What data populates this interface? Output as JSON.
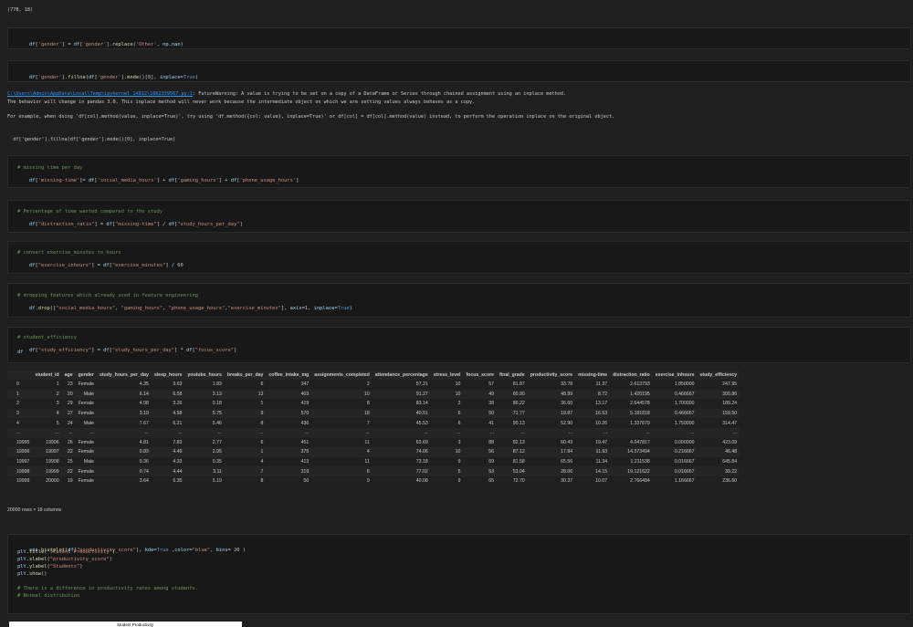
{
  "shape_output": "(778, 18)",
  "cells": [
    {
      "id": "c1",
      "lines": [
        [
          "var",
          "df"
        ],
        [
          "",
          "["
        ],
        [
          "str",
          "'gender'"
        ],
        [
          "",
          "] = "
        ],
        [
          "var",
          "df"
        ],
        [
          "",
          "["
        ],
        [
          "str",
          "'gender'"
        ],
        [
          "",
          "]."
        ],
        [
          "fn",
          "replace"
        ],
        [
          "",
          "("
        ],
        [
          "str",
          "'Other'"
        ],
        [
          "",
          ", "
        ],
        [
          "var",
          "np"
        ],
        [
          "",
          "."
        ],
        [
          "var",
          "nan"
        ],
        [
          "",
          ")"
        ]
      ]
    },
    {
      "id": "c2",
      "lines": [
        [
          "var",
          "df"
        ],
        [
          "",
          "["
        ],
        [
          "str",
          "'gender'"
        ],
        [
          "",
          "]."
        ],
        [
          "fn",
          "fillna"
        ],
        [
          "",
          "("
        ],
        [
          "var",
          "df"
        ],
        [
          "",
          "["
        ],
        [
          "str",
          "'gender'"
        ],
        [
          "",
          "]."
        ],
        [
          "fn",
          "mode"
        ],
        [
          "",
          "()["
        ],
        [
          "num",
          "0"
        ],
        [
          "",
          "], "
        ],
        [
          "var",
          "inplace"
        ],
        [
          "",
          "="
        ],
        [
          "kw",
          "True"
        ],
        [
          "",
          ")"
        ]
      ]
    }
  ],
  "warning": {
    "path": "C:\\Users\\Admin\\AppData\\Local\\Temp\\ipykernel_14812\\1062339567.py:1",
    "line1": ": FutureWarning: A value is trying to be set on a copy of a DataFrame or Series through chained assignment using an inplace method.",
    "line2": "The behavior will change in pandas 3.0. This inplace method will never work because the intermediate object on which we are setting values always behaves as a copy.",
    "line3": "For example, when doing 'df[col].method(value, inplace=True)', try using 'df.method({col: value}, inplace=True)' or df[col] = df[col].method(value) instead, to perform the operation inplace on the original object.",
    "line4": "  df['gender'].fillna(df['gender'].mode()[0], inplace=True)"
  },
  "code_cells": {
    "missing_comment": "# missing time per day",
    "missing_code": "df['missing-time']= df['social_media_hours'] + df['gaming_hours'] + df['phone_usage_hours']",
    "ratio_comment": "# Percentage of time wasted compared to the study",
    "ratio_code": "df[\"distraction_ratio\"] = df[\"missing-time\"] / df[\"study_hours_per_day\"]",
    "exercise_comment": "# convert exercise_minutes to hours",
    "exercise_code": "df[\"exercise_inhours\"] = df[\"exercise_minutes\"] / 60",
    "drop_comment": "# dropping features which already used in feature engineering",
    "drop_code": "df.drop([\"social_media_hours\", \"gaming_hours\", \"phone_usage_hours\",\"exercise_minutes\"], axis=1, inplace=True)",
    "eff_comment": "# student_efficiency",
    "eff_code": "df[\"study_efficiency\"] = df[\"study_hours_per_day\"] * df[\"focus_score\"]",
    "eff_df": "df",
    "plot_l1": "sns.histplot(df[\"productivity_score\"], kde=True ,color=\"blue\", bins= 20 )",
    "plot_l2": "plt.title(\"Student Productivity\")",
    "plot_l3": "plt.xlabel(\"productivity_score\")",
    "plot_l4": "plt.ylabel(\"Students\")",
    "plot_l5": "plt.show()",
    "plot_c1": "# There is a difference in productivity rates among students.",
    "plot_c2": "# Normal distribution"
  },
  "table": {
    "columns": [
      "",
      "student_id",
      "age",
      "gender",
      "study_hours_per_day",
      "sleep_hours",
      "youtube_hours",
      "breaks_per_day",
      "coffee_intake_mg",
      "assignments_completed",
      "attendance_percentage",
      "stress_level",
      "focus_score",
      "final_grade",
      "productivity_score",
      "missing-time",
      "distraction_ratio",
      "exercise_inhours",
      "study_efficiency"
    ],
    "rows": [
      [
        "0",
        "1",
        "23",
        "Female",
        "4.35",
        "3.63",
        "1.83",
        "6",
        "347",
        "2",
        "57.21",
        "10",
        "57",
        "81.87",
        "33.78",
        "11.37",
        "2.613793",
        "1.850000",
        "247.95"
      ],
      [
        "1",
        "2",
        "20",
        "Male",
        "6.14",
        "6.58",
        "3.13",
        "13",
        "403",
        "10",
        "91.27",
        "10",
        "49",
        "60.90",
        "48.99",
        "8.72",
        "1.420195",
        "0.466667",
        "300.86"
      ],
      [
        "2",
        "3",
        "29",
        "Female",
        "4.98",
        "3.26",
        "0.18",
        "1",
        "419",
        "8",
        "83.14",
        "2",
        "38",
        "86.22",
        "36.60",
        "13.17",
        "2.644578",
        "1.700000",
        "189.24"
      ],
      [
        "3",
        "4",
        "27",
        "Female",
        "3.19",
        "4.58",
        "5.75",
        "9",
        "570",
        "18",
        "40.51",
        "6",
        "50",
        "71.77",
        "19.87",
        "16.53",
        "5.181818",
        "0.466667",
        "159.50"
      ],
      [
        "4",
        "5",
        "24",
        "Male",
        "7.67",
        "6.21",
        "5.46",
        "8",
        "436",
        "7",
        "45.53",
        "6",
        "41",
        "90.13",
        "52.90",
        "10.26",
        "1.337679",
        "1.750000",
        "314.47"
      ],
      [
        "...",
        "...",
        "...",
        "...",
        "...",
        "...",
        "...",
        "...",
        "...",
        "...",
        "...",
        "...",
        "...",
        "...",
        "...",
        "...",
        "...",
        "...",
        "..."
      ],
      [
        "19995",
        "19996",
        "26",
        "Female",
        "4.81",
        "7.83",
        "2.77",
        "6",
        "451",
        "11",
        "63.69",
        "3",
        "88",
        "82.13",
        "60.43",
        "19.47",
        "4.047817",
        "0.000000",
        "423.09"
      ],
      [
        "19996",
        "19997",
        "22",
        "Female",
        "0.83",
        "4.49",
        "2.95",
        "1",
        "375",
        "4",
        "74.06",
        "10",
        "56",
        "87.12",
        "17.84",
        "11.93",
        "14.373494",
        "0.216667",
        "46.48"
      ],
      [
        "19997",
        "19998",
        "25",
        "Male",
        "9.36",
        "4.33",
        "0.35",
        "4",
        "413",
        "11",
        "73.18",
        "9",
        "69",
        "81.58",
        "65.56",
        "11.34",
        "1.211538",
        "0.016667",
        "645.84"
      ],
      [
        "19998",
        "19999",
        "22",
        "Female",
        "0.74",
        "4.44",
        "3.11",
        "7",
        "319",
        "6",
        "77.02",
        "5",
        "53",
        "53.04",
        "28.06",
        "14.15",
        "19.121622",
        "0.016667",
        "39.22"
      ],
      [
        "19999",
        "20000",
        "19",
        "Female",
        "3.64",
        "6.35",
        "5.19",
        "8",
        "50",
        "9",
        "40.08",
        "9",
        "65",
        "72.70",
        "30.37",
        "10.07",
        "2.766484",
        "1.166667",
        "236.60"
      ]
    ],
    "footer": "20000 rows × 18 columns"
  },
  "plot_partial_title": "Student Productivity"
}
